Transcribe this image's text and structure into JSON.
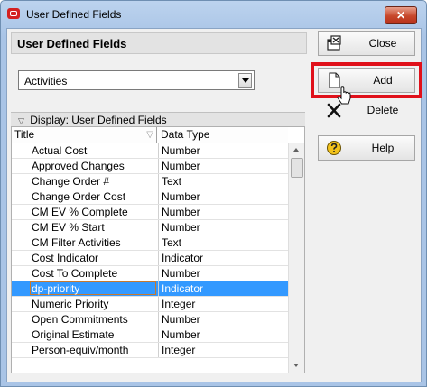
{
  "window": {
    "title": "User Defined Fields",
    "close_glyph": "✕"
  },
  "header": {
    "title": "User Defined Fields"
  },
  "subject_select": {
    "value": "Activities"
  },
  "display_panel": {
    "caret": "▽",
    "label": "Display: User Defined Fields"
  },
  "table": {
    "columns": [
      "Title",
      "Data Type"
    ],
    "filter_glyph": "▽",
    "rows": [
      {
        "title": "Actual Cost",
        "type": "Number"
      },
      {
        "title": "Approved Changes",
        "type": "Number"
      },
      {
        "title": "Change Order #",
        "type": "Text"
      },
      {
        "title": "Change Order Cost",
        "type": "Number"
      },
      {
        "title": "CM EV % Complete",
        "type": "Number"
      },
      {
        "title": "CM EV % Start",
        "type": "Number"
      },
      {
        "title": "CM Filter Activities",
        "type": "Text"
      },
      {
        "title": "Cost Indicator",
        "type": "Indicator"
      },
      {
        "title": "Cost To Complete",
        "type": "Number"
      },
      {
        "title": "dp-priority",
        "type": "Indicator",
        "selected": true
      },
      {
        "title": "Numeric Priority",
        "type": "Integer"
      },
      {
        "title": "Open Commitments",
        "type": "Number"
      },
      {
        "title": "Original Estimate",
        "type": "Number"
      },
      {
        "title": "Person-equiv/month",
        "type": "Integer"
      }
    ]
  },
  "buttons": {
    "close": "Close",
    "add": "Add",
    "delete": "Delete",
    "help": "Help"
  },
  "colors": {
    "selection": "#3399ff",
    "highlight": "#e0101a",
    "help_icon": "#f2c21b"
  }
}
